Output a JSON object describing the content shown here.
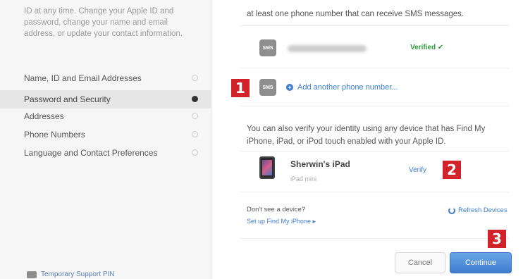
{
  "sidebar": {
    "intro": "ID at any time. Change your Apple ID and password, change your name and email address, or update your contact information.",
    "items": [
      {
        "label": "Name, ID and Email Addresses"
      },
      {
        "label": "Password and Security"
      },
      {
        "label": "Addresses"
      },
      {
        "label": "Phone Numbers"
      },
      {
        "label": "Language and Contact Preferences"
      }
    ],
    "active_index": 1,
    "temp_pin": "Temporary Support PIN"
  },
  "main": {
    "sms_text": "at least one phone number that can receive SMS messages.",
    "sms_icon_label": "SMS",
    "verified_label": "Verified ✔",
    "add_phone_label": "Add another phone number...",
    "verify_identity_text": "You can also verify your identity using any device that has Find My iPhone, iPad, or iPod touch enabled with your Apple ID.",
    "device": {
      "name": "Sherwin's iPad",
      "model": "iPad mini",
      "action": "Verify"
    },
    "no_device": "Don't see a device?",
    "setup_link": "Set up Find My iPhone ▸",
    "refresh_label": "Refresh Devices",
    "cancel_label": "Cancel",
    "continue_label": "Continue"
  },
  "callouts": {
    "one": "1",
    "two": "2",
    "three": "3"
  },
  "colors": {
    "accent": "#3f7ccf",
    "callout": "#d2232a",
    "verified": "#2e9b3a"
  },
  "icons": [
    "chevron-right-icon",
    "sms-icon",
    "plus-icon",
    "ipad-icon",
    "refresh-icon",
    "pin-icon"
  ]
}
